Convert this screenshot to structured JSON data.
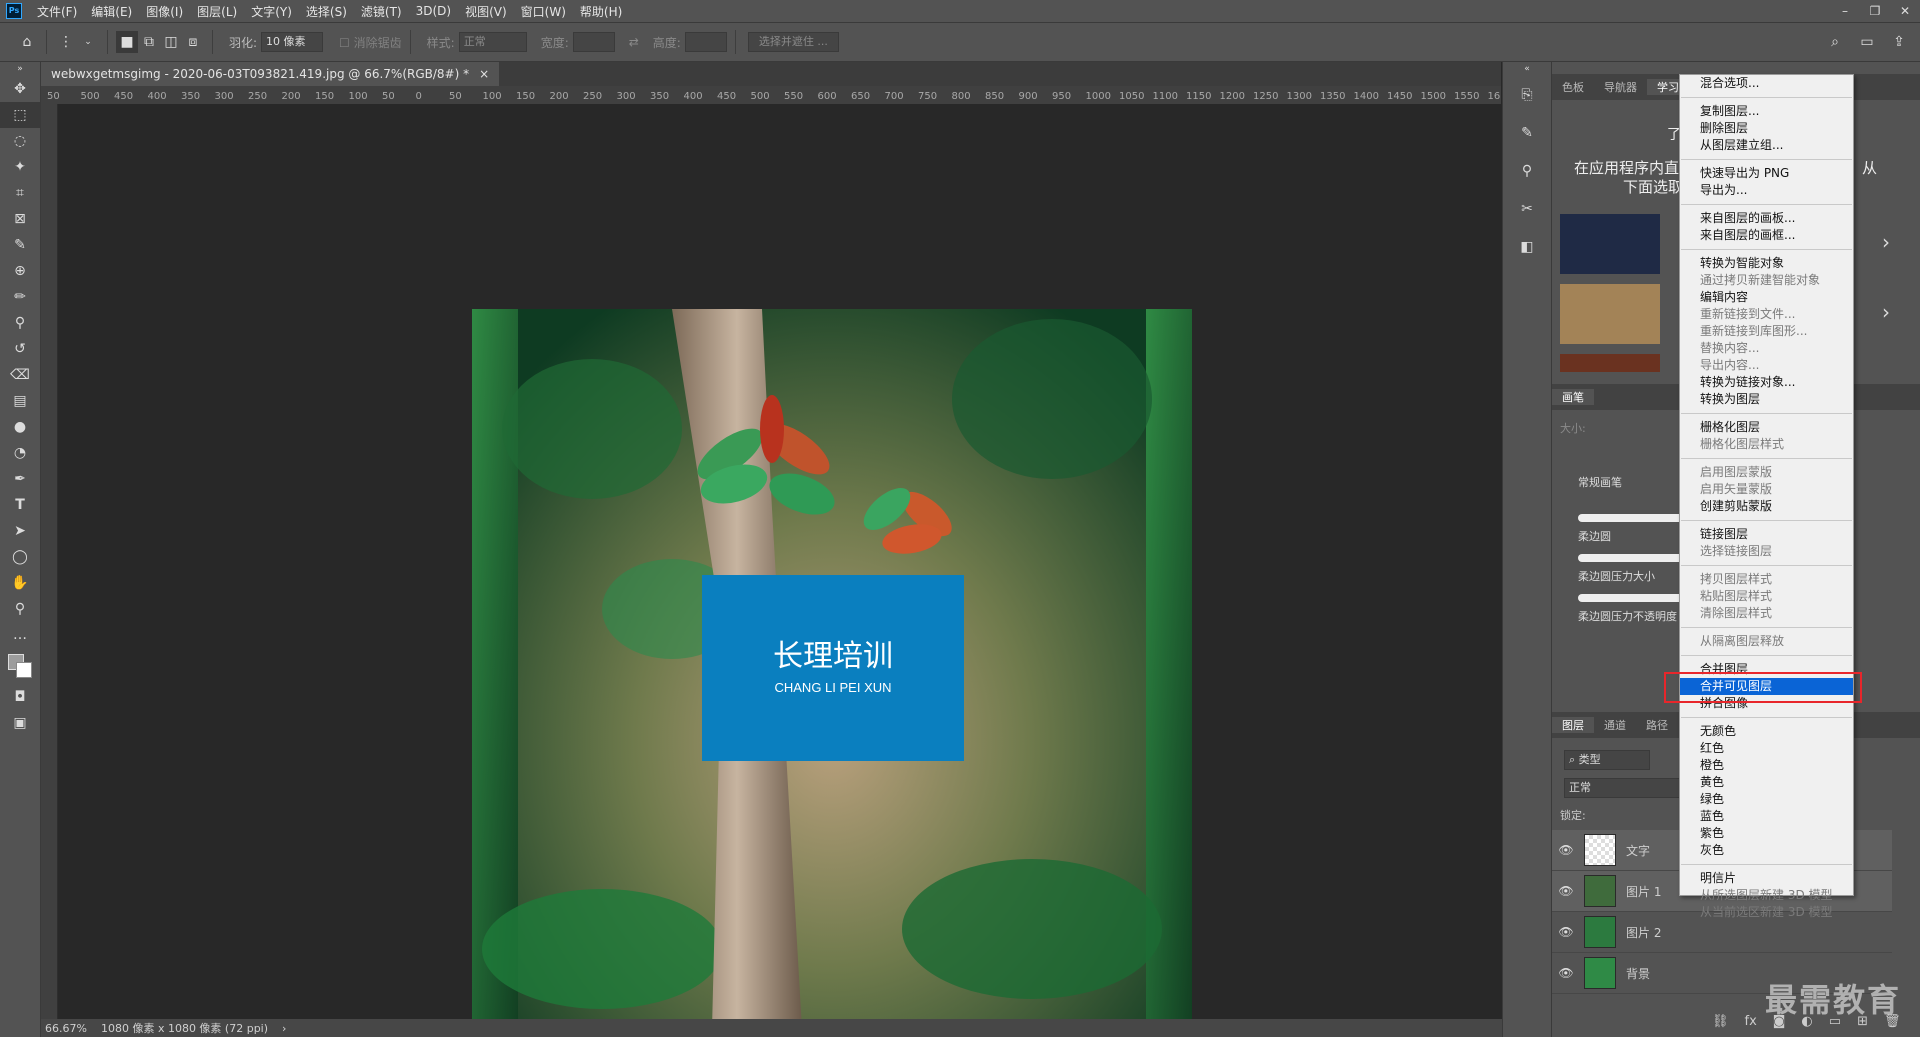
{
  "menubar": {
    "logo": "Ps",
    "items": [
      "文件(F)",
      "编辑(E)",
      "图像(I)",
      "图层(L)",
      "文字(Y)",
      "选择(S)",
      "滤镜(T)",
      "3D(D)",
      "视图(V)",
      "窗口(W)",
      "帮助(H)"
    ]
  },
  "options": {
    "feather_label": "羽化:",
    "feather_value": "10 像素",
    "antialias_label": "消除锯齿",
    "style_label": "样式:",
    "style_value": "正常",
    "width_label": "宽度:",
    "height_label": "高度:",
    "select_mask_label": "选择并遮住 ..."
  },
  "document": {
    "tab_title": "webwxgetmsgimg - 2020-06-03T093821.419.jpg @ 66.7%(RGB/8#) *",
    "close": "×",
    "zoom": "66.67%",
    "size_info": "1080 像素 x 1080 像素 (72 ppi)",
    "status_arrow": "›"
  },
  "ruler_ticks": [
    "50",
    "500",
    "450",
    "400",
    "350",
    "300",
    "250",
    "200",
    "150",
    "100",
    "50",
    "0",
    "50",
    "100",
    "150",
    "200",
    "250",
    "300",
    "350",
    "400",
    "450",
    "500",
    "550",
    "600",
    "650",
    "700",
    "750",
    "800",
    "850",
    "900",
    "950",
    "1000",
    "1050",
    "1100",
    "1150",
    "1200",
    "1250",
    "1300",
    "1350",
    "1400",
    "1450",
    "1500",
    "1550",
    "16"
  ],
  "image": {
    "title": "长理培训",
    "subtitle": "CHANG LI PEI XUN",
    "accent_color": "#0a7fbf"
  },
  "panels": {
    "top_tabs": [
      "色板",
      "导航器",
      "学习"
    ],
    "learn_text_1": "了",
    "learn_text_2": "在应用程序内直",
    "learn_text_3": "下面选取",
    "learn_text_4": "从",
    "brush_tab": "画笔",
    "size_label": "大小:",
    "brush_group": "常规画笔",
    "brushes": [
      "柔边圆",
      "柔边圆压力大小",
      "柔边圆压力不透明度"
    ],
    "layer_tabs": [
      "图层",
      "通道",
      "路径"
    ],
    "kind_filter": "类型",
    "blend_mode": "正常",
    "lock_label": "锁定:",
    "layers": [
      {
        "name": "文字"
      },
      {
        "name": "图片 1"
      },
      {
        "name": "图片 2"
      },
      {
        "name": "背景"
      }
    ]
  },
  "context_menu": {
    "groups": [
      [
        {
          "label": "混合选项...",
          "disabled": false
        }
      ],
      [
        {
          "label": "复制图层...",
          "disabled": false
        },
        {
          "label": "删除图层",
          "disabled": false
        },
        {
          "label": "从图层建立组...",
          "disabled": false
        }
      ],
      [
        {
          "label": "快速导出为 PNG",
          "disabled": false
        },
        {
          "label": "导出为...",
          "disabled": false
        }
      ],
      [
        {
          "label": "来自图层的画板...",
          "disabled": false
        },
        {
          "label": "来自图层的画框...",
          "disabled": false
        }
      ],
      [
        {
          "label": "转换为智能对象",
          "disabled": false
        },
        {
          "label": "通过拷贝新建智能对象",
          "disabled": true
        },
        {
          "label": "编辑内容",
          "disabled": false
        },
        {
          "label": "重新链接到文件...",
          "disabled": true
        },
        {
          "label": "重新链接到库图形...",
          "disabled": true
        },
        {
          "label": "替换内容...",
          "disabled": true
        },
        {
          "label": "导出内容...",
          "disabled": true
        },
        {
          "label": "转换为链接对象...",
          "disabled": false
        },
        {
          "label": "转换为图层",
          "disabled": false
        }
      ],
      [
        {
          "label": "栅格化图层",
          "disabled": false
        },
        {
          "label": "栅格化图层样式",
          "disabled": true
        }
      ],
      [
        {
          "label": "启用图层蒙版",
          "disabled": true
        },
        {
          "label": "启用矢量蒙版",
          "disabled": true
        },
        {
          "label": "创建剪贴蒙版",
          "disabled": false
        }
      ],
      [
        {
          "label": "链接图层",
          "disabled": false
        },
        {
          "label": "选择链接图层",
          "disabled": true
        }
      ],
      [
        {
          "label": "拷贝图层样式",
          "disabled": true
        },
        {
          "label": "粘贴图层样式",
          "disabled": true
        },
        {
          "label": "清除图层样式",
          "disabled": true
        }
      ],
      [
        {
          "label": "从隔离图层释放",
          "disabled": true
        }
      ],
      [
        {
          "label": "合并图层",
          "disabled": false
        },
        {
          "label": "合并可见图层",
          "disabled": false,
          "highlighted": true
        },
        {
          "label": "拼合图像",
          "disabled": false
        }
      ],
      [
        {
          "label": "无颜色",
          "disabled": false
        },
        {
          "label": "红色",
          "disabled": false
        },
        {
          "label": "橙色",
          "disabled": false
        },
        {
          "label": "黄色",
          "disabled": false
        },
        {
          "label": "绿色",
          "disabled": false
        },
        {
          "label": "蓝色",
          "disabled": false
        },
        {
          "label": "紫色",
          "disabled": false
        },
        {
          "label": "灰色",
          "disabled": false
        }
      ],
      [
        {
          "label": "明信片",
          "disabled": false
        },
        {
          "label": "从所选图层新建 3D 模型",
          "disabled": true
        },
        {
          "label": "从当前选区新建 3D 模型",
          "disabled": true
        }
      ]
    ]
  },
  "watermark": "最需教育"
}
